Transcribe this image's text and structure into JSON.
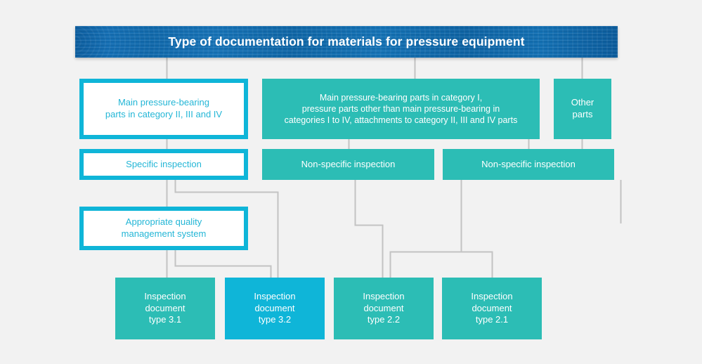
{
  "diagram": {
    "title": "Type of documentation for materials for pressure equipment",
    "background_color": "#f2f2f2",
    "colors": {
      "header_blue": "#1064a8",
      "teal": "#2cbdb5",
      "cyan": "#0fb5d8",
      "outline_border": "#0fb5d8",
      "outline_text": "#23b6d6",
      "connector_line": "#c3c3c3",
      "white_text": "#ffffff"
    },
    "header": {
      "label": "Type of documentation for materials for pressure equipment"
    },
    "level_1": [
      {
        "id": "main-parts-cat-2-3-4",
        "label": "Main pressure-bearing\nparts in category II, III and IV",
        "style": "outline"
      },
      {
        "id": "main-parts-cat-1",
        "label": "Main pressure-bearing parts in category I,\npressure parts other than main pressure-bearing in\ncategories I to IV, attachments to category II, III and IV parts",
        "style": "teal"
      },
      {
        "id": "other-parts",
        "label": "Other\nparts",
        "style": "teal"
      }
    ],
    "level_2": [
      {
        "id": "specific-inspection",
        "label": "Specific inspection",
        "style": "outline"
      },
      {
        "id": "non-specific-inspection-1",
        "label": "Non-specific inspection",
        "style": "teal"
      },
      {
        "id": "non-specific-inspection-2",
        "label": "Non-specific inspection",
        "style": "teal"
      }
    ],
    "level_3": [
      {
        "id": "appropriate-quality-management-system",
        "label": "Appropriate quality\nmanagement system",
        "style": "outline"
      }
    ],
    "level_4": [
      {
        "id": "inspection-document-type-3-1",
        "label": "Inspection\ndocument\ntype 3.1",
        "style": "teal"
      },
      {
        "id": "inspection-document-type-3-2",
        "label": "Inspection\ndocument\ntype 3.2",
        "style": "cyan"
      },
      {
        "id": "inspection-document-type-2-2",
        "label": "Inspection\ndocument\ntype 2.2",
        "style": "teal"
      },
      {
        "id": "inspection-document-type-2-1",
        "label": "Inspection\ndocument\ntype 2.1",
        "style": "teal"
      }
    ]
  }
}
